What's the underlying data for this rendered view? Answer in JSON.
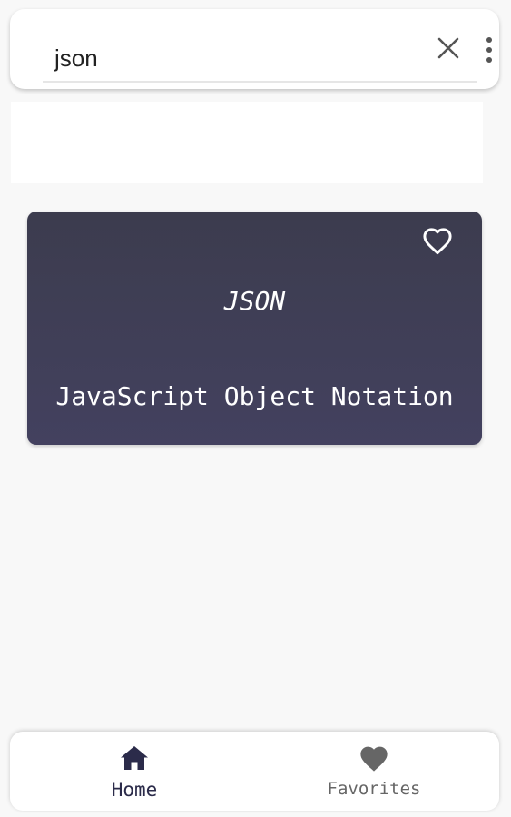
{
  "search": {
    "query": "json"
  },
  "icons": {
    "clear": "close-icon",
    "menu": "more-vertical-icon",
    "favorite": "heart-outline-icon",
    "home": "home-icon",
    "favorites_nav": "heart-filled-icon"
  },
  "card": {
    "abbreviation": "JSON",
    "full_name": "JavaScript Object Notation"
  },
  "nav": {
    "home_label": "Home",
    "favorites_label": "Favorites"
  },
  "colors": {
    "card_background": "#3f3e55",
    "active_nav": "#2b2b4a",
    "inactive_nav": "#666666"
  }
}
